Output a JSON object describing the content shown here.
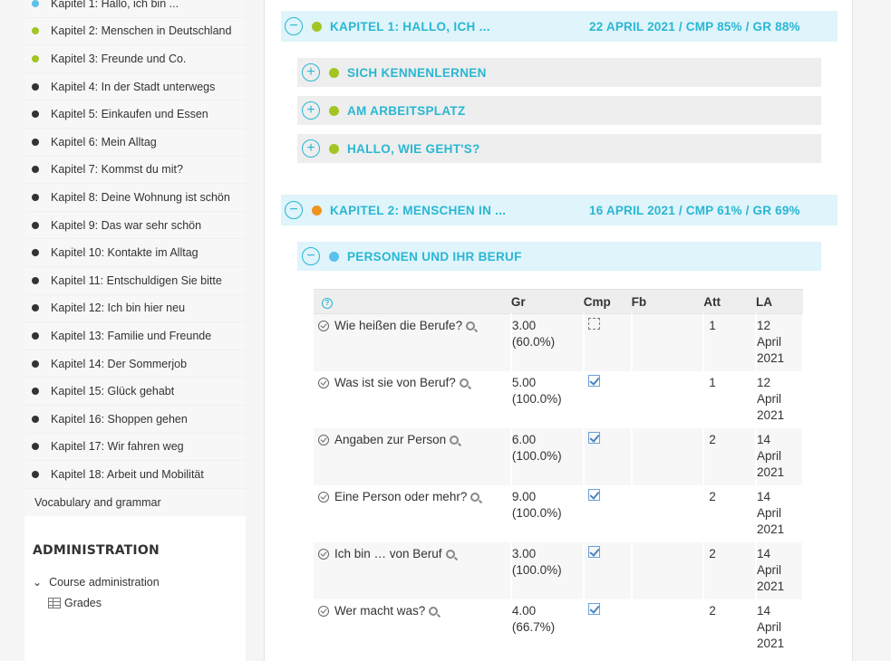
{
  "sidebar": {
    "chapters": [
      {
        "label": "Kapitel 1: Hallo, ich bin ...",
        "dot": "#5bc0eb"
      },
      {
        "label": "Kapitel 2: Menschen in Deutschland",
        "dot": "#a2c523"
      },
      {
        "label": "Kapitel 3: Freunde und Co.",
        "dot": "#a2c523"
      },
      {
        "label": "Kapitel 4: In der Stadt unterwegs",
        "dot": "#333333"
      },
      {
        "label": "Kapitel 5: Einkaufen und Essen",
        "dot": "#333333"
      },
      {
        "label": "Kapitel 6: Mein Alltag",
        "dot": "#333333"
      },
      {
        "label": "Kapitel 7: Kommst du mit?",
        "dot": "#333333"
      },
      {
        "label": "Kapitel 8: Deine Wohnung ist schön",
        "dot": "#333333"
      },
      {
        "label": "Kapitel 9: Das war sehr schön",
        "dot": "#333333"
      },
      {
        "label": "Kapitel 10: Kontakte im Alltag",
        "dot": "#333333"
      },
      {
        "label": "Kapitel 11: Entschuldigen Sie bitte",
        "dot": "#333333"
      },
      {
        "label": "Kapitel 12: Ich bin hier neu",
        "dot": "#333333"
      },
      {
        "label": "Kapitel 13: Familie und Freunde",
        "dot": "#333333"
      },
      {
        "label": "Kapitel 14: Der Sommerjob",
        "dot": "#333333"
      },
      {
        "label": "Kapitel 15: Glück gehabt",
        "dot": "#333333"
      },
      {
        "label": "Kapitel 16: Shoppen gehen",
        "dot": "#333333"
      },
      {
        "label": "Kapitel 17: Wir fahren weg",
        "dot": "#333333"
      },
      {
        "label": "Kapitel 18: Arbeit und Mobilität",
        "dot": "#333333"
      }
    ],
    "vocab_label": "Vocabulary and grammar",
    "admin": {
      "heading": "ADMINISTRATION",
      "course_admin_label": "Course administration",
      "grades_label": "Grades"
    }
  },
  "main": {
    "colors": {
      "accent": "#29b7d3",
      "green": "#a2c523",
      "orange": "#f0931c",
      "blue": "#5bc0eb"
    },
    "sections": [
      {
        "title": "KAPITEL 1: HALLO, ICH ...",
        "meta": "22 APRIL 2021 / CMP 85% / GR 88%",
        "toggle": "−",
        "dot": "#a2c523",
        "activities": [
          {
            "title": "SICH KENNENLERNEN",
            "toggle": "+",
            "dot": "#a2c523"
          },
          {
            "title": "AM ARBEITSPLATZ",
            "toggle": "+",
            "dot": "#a2c523"
          },
          {
            "title": "HALLO, WIE GEHT'S?",
            "toggle": "+",
            "dot": "#a2c523"
          }
        ]
      },
      {
        "title": "KAPITEL 2: MENSCHEN IN ...",
        "meta": "16 APRIL 2021 / CMP 61% / GR 69%",
        "toggle": "−",
        "dot": "#f0931c",
        "activities": [
          {
            "title": "PERSONEN UND IHR BERUF",
            "toggle": "−",
            "dot": "#5bc0eb"
          }
        ]
      }
    ],
    "table": {
      "headers": {
        "gr": "Gr",
        "cmp": "Cmp",
        "fb": "Fb",
        "att": "Att",
        "la": "LA"
      },
      "rows": [
        {
          "name": "Wie heißen die Berufe?",
          "gr": "3.00",
          "pct": "(60.0%)",
          "cmp": false,
          "fb": "",
          "att": "1",
          "la1": "12",
          "la2": "April",
          "la3": "2021"
        },
        {
          "name": "Was ist sie von Beruf?",
          "gr": "5.00",
          "pct": "(100.0%)",
          "cmp": true,
          "fb": "",
          "att": "1",
          "la1": "12",
          "la2": "April",
          "la3": "2021"
        },
        {
          "name": "Angaben zur Person",
          "gr": "6.00",
          "pct": "(100.0%)",
          "cmp": true,
          "fb": "",
          "att": "2",
          "la1": "14",
          "la2": "April",
          "la3": "2021"
        },
        {
          "name": "Eine Person oder mehr?",
          "gr": "9.00",
          "pct": "(100.0%)",
          "cmp": true,
          "fb": "",
          "att": "2",
          "la1": "14",
          "la2": "April",
          "la3": "2021"
        },
        {
          "name": "Ich bin … von Beruf",
          "gr": "3.00",
          "pct": "(100.0%)",
          "cmp": true,
          "fb": "",
          "att": "2",
          "la1": "14",
          "la2": "April",
          "la3": "2021"
        },
        {
          "name": "Wer macht was?",
          "gr": "4.00",
          "pct": "(66.7%)",
          "cmp": true,
          "fb": "",
          "att": "2",
          "la1": "14",
          "la2": "April",
          "la3": "2021"
        }
      ]
    }
  }
}
